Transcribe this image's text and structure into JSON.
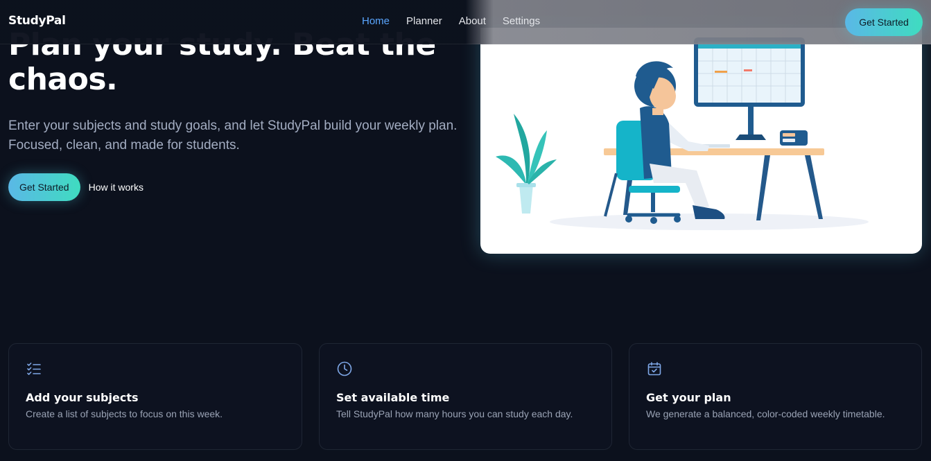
{
  "nav": {
    "brand": "StudyPal",
    "links": [
      {
        "label": "Home",
        "active": true
      },
      {
        "label": "Planner",
        "active": false
      },
      {
        "label": "About",
        "active": false
      },
      {
        "label": "Settings",
        "active": false
      }
    ],
    "cta": "Get Started"
  },
  "hero": {
    "title": "Plan your study. Beat the\nchaos.",
    "subtitle": "Enter your subjects and study goals, and let StudyPal build your weekly plan. Focused, clean, and made for students.",
    "primary_button": "Get Started",
    "secondary_link": "How it works"
  },
  "features": [
    {
      "icon": "checklist-icon",
      "title": "Add your subjects",
      "desc": "Create a list of subjects to focus on this week."
    },
    {
      "icon": "clock-icon",
      "title": "Set available time",
      "desc": "Tell StudyPal how many hours you can study each day."
    },
    {
      "icon": "calendar-check-icon",
      "title": "Get your plan",
      "desc": "We generate a balanced, color-coded weekly timetable."
    }
  ],
  "colors": {
    "background": "#0c111d",
    "accent_blue": "#5aa6ff",
    "gradient_start": "#5ab8e6",
    "gradient_end": "#3fdcc0"
  }
}
